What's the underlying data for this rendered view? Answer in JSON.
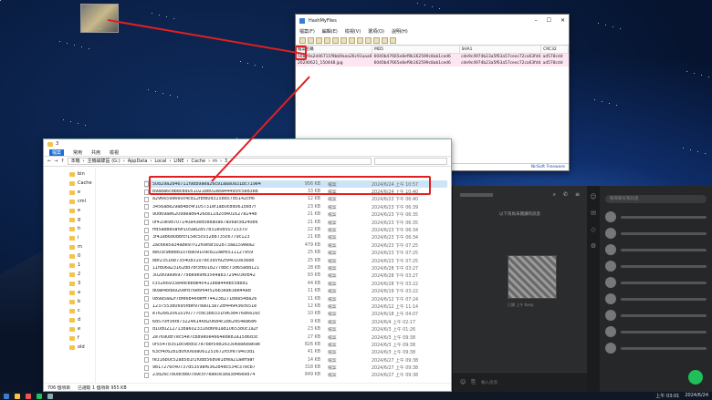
{
  "desktop": {
    "icon_label": "..."
  },
  "hashmyfiles": {
    "title": "HashMyFiles",
    "menu": [
      "檔案(F)",
      "編輯(E)",
      "檢視(V)",
      "選項(O)",
      "說明(H)"
    ],
    "columns": [
      "檔案名稱",
      "MD5",
      "SHA1",
      "CRC32"
    ],
    "rows": [
      {
        "name": "50829a2d46711f9bb9aea26c91aaa0a31...",
        "md5": "6040b47665e8ef9b162599c8ab1ced6",
        "sha1": "cde9c4974b23a5f63a57ceec72ca63fd4...",
        "crc": "ad578cdd"
      },
      {
        "name": "20240621_150448.jpg",
        "md5": "6040b47665e8ef9b162599c8ab1ced6",
        "sha1": "cde9c4974b23a5f63a57ceec72ca63fd4...",
        "crc": "ad578cdd"
      }
    ],
    "status_left": "2 個檔案",
    "status_right": "NirSoft Freeware"
  },
  "explorer": {
    "title": "3",
    "ribbon": [
      "檔案",
      "常用",
      "共用",
      "檢視"
    ],
    "path": [
      "本機",
      "主機磁碟區 (G:)",
      "AppData",
      "Local",
      "LINE",
      "Cache",
      "m",
      "3"
    ],
    "nav": [
      "bin",
      "Cache",
      "e",
      "cml",
      "e",
      "g",
      "h",
      "i",
      "m",
      "0",
      "1",
      "2",
      "3",
      "a",
      "b",
      "c",
      "d",
      "e",
      "f",
      "old"
    ],
    "files": [
      {
        "name": "50829a2d46711f9bb9aea26c91aaa0a31bc719e4",
        "size": "956 KB",
        "type": "檔案",
        "date": "2024/6/24 上午 10:57"
      },
      {
        "name": "b9ada6cdbdc8d051021b801e8a44495fc5ed3eb",
        "size": "33 KB",
        "type": "檔案",
        "date": "2024/6/24 上午 10:40"
      },
      {
        "name": "a2966599660c4cd12fbfb0d3158b57d5142cff6",
        "size": "12 KB",
        "type": "檔案",
        "date": "2024/6/23 下午 06:40"
      },
      {
        "name": "3456a8e29ab4bc4f105731ef1ab0c8d061ced7f",
        "size": "23 KB",
        "type": "檔案",
        "date": "2024/6/23 下午 06:39"
      },
      {
        "name": "90d69ae62098ead6426ce11d2cd401627a144b",
        "size": "21 KB",
        "type": "檔案",
        "date": "2024/6/23 下午 06:35"
      },
      {
        "name": "0f410e9d707140a43ed5b8a0a67a06af3d240b6",
        "size": "21 KB",
        "type": "檔案",
        "date": "2024/6/23 下午 06:35"
      },
      {
        "name": "ffd5abb80af9f105ab2857831e0d50723370",
        "size": "22 KB",
        "type": "檔案",
        "date": "2024/6/23 下午 06:34"
      },
      {
        "name": "3f41eb6d0bbfcf15ec5c03288735c6779c123",
        "size": "21 KB",
        "type": "檔案",
        "date": "2024/6/23 下午 06:34"
      },
      {
        "name": "2ac66e5a34a8e97f12f0efaf302873aa159eea2",
        "size": "479 KB",
        "type": "檔案",
        "date": "2024/6/23 下午 07:25"
      },
      {
        "name": "8e03c9be8b107ba09109c822aef6511127959",
        "size": "25 KB",
        "type": "檔案",
        "date": "2024/6/23 下午 07:25"
      },
      {
        "name": "8bf23516b73540831078c395f92f94010e3688",
        "size": "25 KB",
        "type": "檔案",
        "date": "2024/6/23 下午 07:25"
      },
      {
        "name": "11fd06a23162dd7df3fb0182778bc73d65add121",
        "size": "28 KB",
        "type": "檔案",
        "date": "2024/6/28 下午 03:27"
      },
      {
        "name": "302809a969779be9e9fb3564ab37294036fb42",
        "size": "93 KB",
        "type": "檔案",
        "date": "2024/6/28 下午 03:27"
      },
      {
        "name": "c35266933a4dcebde4c4118ba44ebc5dbd1",
        "size": "44 KB",
        "type": "檔案",
        "date": "2024/6/28 下午 03:22"
      },
      {
        "name": "d0ae4bda920efd76e6f64f526b3ea63ee44ad",
        "size": "11 KB",
        "type": "檔案",
        "date": "2024/6/19 下午 03:22"
      },
      {
        "name": "089a5aa2f7bfe6b46defff74423b271bea54ba26",
        "size": "11 KB",
        "type": "檔案",
        "date": "2024/6/12 下午 07:24"
      },
      {
        "name": "1237553b0695fdef978a013a72df449436c651e",
        "size": "12 KB",
        "type": "檔案",
        "date": "2024/6/12 上午 11:14"
      },
      {
        "name": "e76266206101f0777cdc3bb331f963847686616c",
        "size": "10 KB",
        "type": "檔案",
        "date": "2024/6/18 上午 04:07"
      },
      {
        "name": "6d570ff36f8732246146d20684c1b62d54ea686",
        "size": "9 KB",
        "type": "檔案",
        "date": "2024/6/4 上午 02:17"
      },
      {
        "name": "d10d0212713ba6023316d6fe1ad1065380c1a2f",
        "size": "23 KB",
        "type": "檔案",
        "date": "2024/6/3 上午 01:26"
      },
      {
        "name": "2e7690bf7ec54e7cb89e0e4664ede81a15d6d3c",
        "size": "27 KB",
        "type": "檔案",
        "date": "2024/6/3 上午 09:38"
      },
      {
        "name": "0f55478351bc98d5c7e7b8f5dd163306ea68a69e",
        "size": "826 KB",
        "type": "檔案",
        "date": "2024/6/3 上午 09:38"
      },
      {
        "name": "63cf4c6281d0f0069a061253672fc0fe79403d1",
        "size": "41 KB",
        "type": "檔案",
        "date": "2024/6/3 上午 09:38"
      },
      {
        "name": "fe316b0c52ab5d1f1f0bb5680e1dfea21aeff9af",
        "size": "14 KB",
        "type": "檔案",
        "date": "2024/6/27 上午 09:38"
      },
      {
        "name": "9817276c40737d5359af6362b4dc534c37ecb7",
        "size": "318 KB",
        "type": "檔案",
        "date": "2024/6/27 上午 09:38"
      },
      {
        "name": "23d26c7b0dcdd07d9c5f7ea6ce38a3d46e9d74",
        "size": "849 KB",
        "type": "檔案",
        "date": "2024/6/27 上午 09:38"
      }
    ],
    "status": [
      "706 個項目",
      "已選取 1 個項目 955 KB"
    ]
  },
  "line": {
    "date_label": "以下為尚未閱讀的訊息",
    "input_hint": "輸入訊息",
    "search_placeholder": "搜尋聊天和訊息",
    "time_text": "已讀 上午 Keep"
  },
  "taskbar": {
    "time": "上午 03:01",
    "date": "2024/6/24"
  },
  "colors": {
    "annotation": "#e02020",
    "highlight": "#cce4f7",
    "hash_row": "#fde6f2",
    "line_green": "#1fbf5a"
  }
}
